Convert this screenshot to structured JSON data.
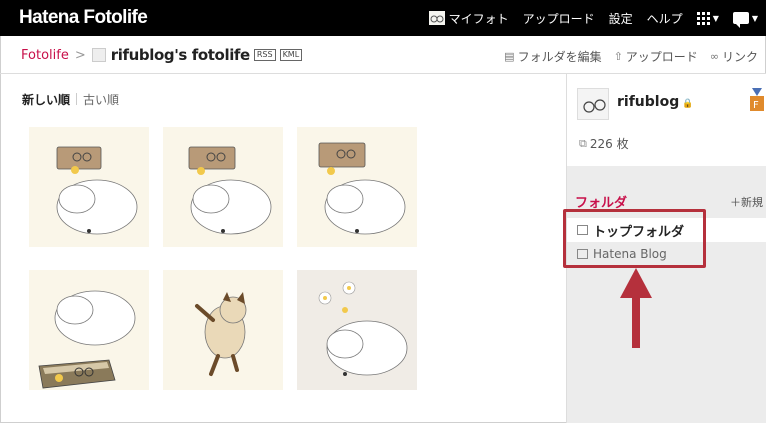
{
  "topbar": {
    "logo": "Hatena Fotolife",
    "nav": [
      "マイフォト",
      "アップロード",
      "設定",
      "ヘルプ"
    ]
  },
  "breadcrumb": {
    "home": "Fotolife",
    "separator": ">",
    "title": "rifublog's fotolife",
    "tags": [
      "RSS",
      "KML"
    ]
  },
  "actions": {
    "edit_folder": "フォルダを編集",
    "upload": "アップロード",
    "link": "リンク"
  },
  "sort": {
    "newest": "新しい順",
    "oldest": "古い順"
  },
  "gallery": {
    "thumbs": [
      {
        "name": "dog-sleeping-glasses-1",
        "variant": "folder"
      },
      {
        "name": "dog-sleeping-glasses-2",
        "variant": "folder"
      },
      {
        "name": "dog-sleeping-glasses-3",
        "variant": "folder"
      },
      {
        "name": "dog-sleeping-book",
        "variant": "book"
      },
      {
        "name": "cat-dancing",
        "variant": "cat"
      },
      {
        "name": "dog-sleeping-flowers",
        "variant": "flowers"
      }
    ]
  },
  "profile": {
    "username": "rifublog",
    "count": "226 枚"
  },
  "folders": {
    "label": "フォルダ",
    "new": "新規",
    "items": [
      "トップフォルダ",
      "Hatena Blog"
    ]
  },
  "colors": {
    "accent": "#c8104a",
    "highlight": "#b5303c"
  }
}
